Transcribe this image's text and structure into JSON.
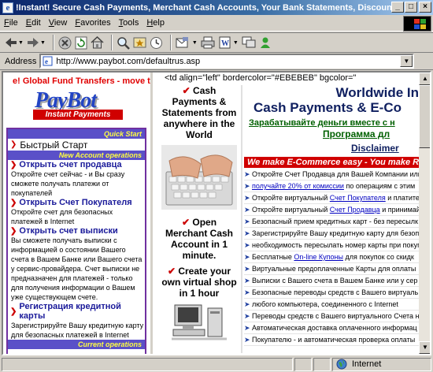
{
  "window": {
    "title": "!Instant! Secure Cash Payments, Merchant Cash Accounts, Your Bank Statements, Discount Co...",
    "controls": [
      "_",
      "□",
      "×"
    ]
  },
  "menu": [
    "File",
    "Edit",
    "View",
    "Favorites",
    "Tools",
    "Help"
  ],
  "address": {
    "label": "Address",
    "url": "http://www.paybot.com/defaultrus.asp"
  },
  "left": {
    "marquee": "e! Global Fund Transfers - move t",
    "logo": {
      "main": "PayBot",
      "sub": "Instant Payments"
    },
    "quick_start_bar": "Quick Start",
    "quick_start_item": "Быстрый Старт",
    "new_account_bar": "New Account operations",
    "sections": [
      {
        "title": "Открыть счет продавца",
        "desc": "Откройте счет сейчас - и Вы сразу сможете получать платежи от покупателей"
      },
      {
        "title": "Открыть Счет Покупателя",
        "desc": "Откройте счет для безопасных платежей в Internet"
      },
      {
        "title": "Открыть счет выписки",
        "desc": "Вы сможете получать выписки с информацией о состоянии Вашего счета в Вашем Банке или Вашего счета у сервис-провайдера. Счет выписки не предназначен для платежей - только для получения информации о Вашем уже существующем счете."
      },
      {
        "title": "Регистрация кредитной карты",
        "desc": "Зарегистрируйте Вашу кредитную карту для безопасных платежей в Internet"
      }
    ],
    "current_ops_bar": "Current operations"
  },
  "right": {
    "code_line": "<td align=\"left\" bordercolor=\"#EBEBEB\" bgcolor=\"",
    "promos": [
      "Cash Payments & Statements from anywhere in the World",
      "Open Merchant Cash Account in 1 minute.",
      "Create your own virtual shop in 1 hour"
    ],
    "title1": "Worldwide In",
    "title2": "Cash Payments & E-Co",
    "green1": "Зарабатывайте деньги вместе с н",
    "green2": "Программа дл",
    "disclaimer": "Disclaimer",
    "banner": "We make E-Commerce easy - You make R",
    "bullets": [
      {
        "pre": "Откройте Счет Продавца для Вашей Компании или",
        "link": "",
        "post": ""
      },
      {
        "pre": "",
        "link": "получайте 20% от комиссии",
        "post": " по операциям с этим"
      },
      {
        "pre": "Откройте виртуальный ",
        "link": "Счет Покупателя",
        "post": " и платите"
      },
      {
        "pre": "Откройте виртуальный ",
        "link": "Счет Продавца",
        "post": " и принимай"
      },
      {
        "pre": "Безопасный прием кредитных карт - без пересылк",
        "link": "",
        "post": ""
      },
      {
        "pre": "Зарегистрируйте Вашу кредитную карту для безопа",
        "link": "",
        "post": ""
      },
      {
        "pre": "необходимость пересылать номер карты при покуп",
        "link": "",
        "post": ""
      },
      {
        "pre": "Бесплатные ",
        "link": "On-line Купоны",
        "post": " для покупок со скидк"
      },
      {
        "pre": "Виртуальные предоплаченные Карты для оплаты",
        "link": "",
        "post": ""
      },
      {
        "pre": "Выписки с Вашего счета в Вашем Банке или у сер",
        "link": "",
        "post": ""
      },
      {
        "pre": "Безопасные переводы средств с Вашего виртуаль",
        "link": "",
        "post": ""
      },
      {
        "pre": "любого компьютера, соединенного с Internet",
        "link": "",
        "post": ""
      },
      {
        "pre": "Переводы средств с Вашего виртуального Счета н",
        "link": "",
        "post": ""
      },
      {
        "pre": "Автоматическая доставка оплаченного информац",
        "link": "",
        "post": ""
      },
      {
        "pre": "Покупателю - и автоматическая проверка оплаты",
        "link": "",
        "post": ""
      }
    ]
  },
  "status": {
    "zone": "Internet"
  }
}
